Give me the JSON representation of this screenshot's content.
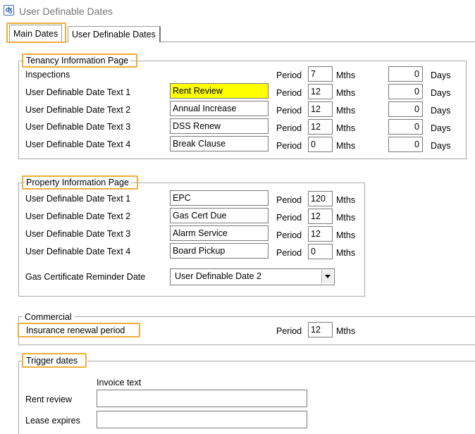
{
  "window": {
    "title": "User Definable Dates"
  },
  "tabs": [
    {
      "label": "Main Dates"
    },
    {
      "label": "User Definable Dates"
    }
  ],
  "tenancy": {
    "title": "Tenancy Information Page",
    "period_label": "Period",
    "mths_label": "Mths",
    "days_label": "Days",
    "rows": [
      {
        "label": "Inspections",
        "text": "",
        "period": "7",
        "days": "0"
      },
      {
        "label": "User Definable Date Text 1",
        "text": "Rent Review",
        "period": "12",
        "days": "0"
      },
      {
        "label": "User Definable Date Text 2",
        "text": "Annual Increase",
        "period": "12",
        "days": "0"
      },
      {
        "label": "User Definable Date Text 3",
        "text": "DSS Renew",
        "period": "12",
        "days": "0"
      },
      {
        "label": "User Definable Date Text 4",
        "text": "Break Clause",
        "period": "0",
        "days": "0"
      }
    ]
  },
  "property": {
    "title": "Property Information Page",
    "period_label": "Period",
    "mths_label": "Mths",
    "rows": [
      {
        "label": "User Definable Date Text 1",
        "text": "EPC",
        "period": "120"
      },
      {
        "label": "User Definable Date Text 2",
        "text": "Gas Cert Due",
        "period": "12"
      },
      {
        "label": "User Definable Date Text 3",
        "text": "Alarm Service",
        "period": "12"
      },
      {
        "label": "User Definable Date Text 4",
        "text": "Board Pickup",
        "period": "0"
      }
    ],
    "gas_label": "Gas Certificate Reminder Date",
    "gas_value": "User Definable Date 2"
  },
  "commercial": {
    "title": "Commercial",
    "label": "Insurance renewal period",
    "period_label": "Period",
    "period": "12",
    "mths_label": "Mths"
  },
  "trigger": {
    "title": "Trigger dates",
    "invoice_header": "Invoice text",
    "rent_review_label": "Rent review",
    "rent_review_value": "",
    "lease_expires_label": "Lease expires",
    "lease_expires_value": ""
  },
  "colors": {
    "highlight": "#f0ad3a",
    "field_highlight": "#ffff00"
  }
}
